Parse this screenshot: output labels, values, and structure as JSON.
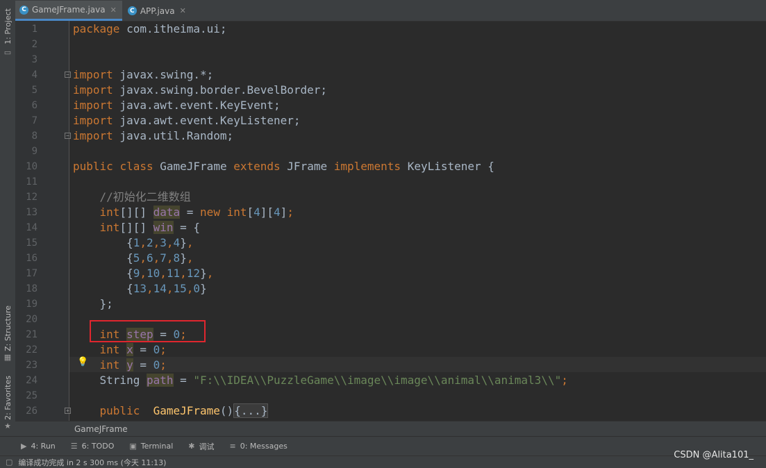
{
  "tabs": [
    {
      "label": "GameJFrame.java",
      "icon": "c-class-icon"
    },
    {
      "label": "APP.java",
      "icon": "c-class-icon"
    }
  ],
  "left_tools": {
    "project": "1: Project",
    "structure": "Z: Structure",
    "favorites": "2: Favorites"
  },
  "line_numbers": [
    "1",
    "2",
    "3",
    "4",
    "5",
    "6",
    "7",
    "8",
    "9",
    "10",
    "11",
    "12",
    "13",
    "14",
    "15",
    "16",
    "17",
    "18",
    "19",
    "20",
    "21",
    "22",
    "23",
    "24",
    "25",
    "26"
  ],
  "code": {
    "l1_kw": "package",
    "l1_rest": " com.itheima.ui;",
    "import_kw": "import",
    "l4": " javax.swing.*;",
    "l5": " javax.swing.border.BevelBorder;",
    "l6": " java.awt.event.KeyEvent;",
    "l7": " java.awt.event.KeyListener;",
    "l8": " java.util.Random;",
    "public": "public",
    "class": "class",
    "classname": "GameJFrame",
    "extends": "extends",
    "jframe": "JFrame",
    "implements": "implements",
    "keylistener": "KeyListener {",
    "comment": "//初始化二维数组",
    "int_arr": "int",
    "brackets": "[][] ",
    "data_field": "data",
    "eq": " = ",
    "new_kw": "new",
    "int_new": " int",
    "dims": "[4][4]",
    "win_field": "win",
    "open_brace": "= {",
    "row1": [
      "1",
      "2",
      "3",
      "4"
    ],
    "row2": [
      "5",
      "6",
      "7",
      "8"
    ],
    "row3": [
      "9",
      "10",
      "11",
      "12"
    ],
    "row4": [
      "13",
      "14",
      "15",
      "0"
    ],
    "close": "};",
    "int_kw": "int",
    "step_field": "step",
    "x_field": "x",
    "y_field": "y",
    "zero": "0",
    "string_type": "String ",
    "path_field": "path",
    "path_value": "\"F:\\\\IDEA\\\\PuzzleGame\\\\image\\\\image\\\\animal\\\\animal3\\\\\"",
    "ctor_name": "GameJFrame",
    "ctor_parens": "()",
    "folded": "{...}"
  },
  "breadcrumb": "GameJFrame",
  "tool_windows": [
    {
      "label": "4: Run",
      "icon": "play-icon"
    },
    {
      "label": "6: TODO",
      "icon": "list-icon"
    },
    {
      "label": "Terminal",
      "icon": "terminal-icon"
    },
    {
      "label": "调试",
      "icon": "bug-icon"
    },
    {
      "label": "0: Messages",
      "icon": "messages-icon"
    }
  ],
  "status_text": "编译成功完成 in 2 s 300 ms (今天 11:13)",
  "watermark": "CSDN @Alita101_",
  "colors": {
    "background": "#2b2b2b",
    "keyword": "#cc7832",
    "number": "#6897bb",
    "string": "#6a8759",
    "comment": "#808080",
    "field": "#9876aa",
    "highlight_box": "#e0262e"
  }
}
